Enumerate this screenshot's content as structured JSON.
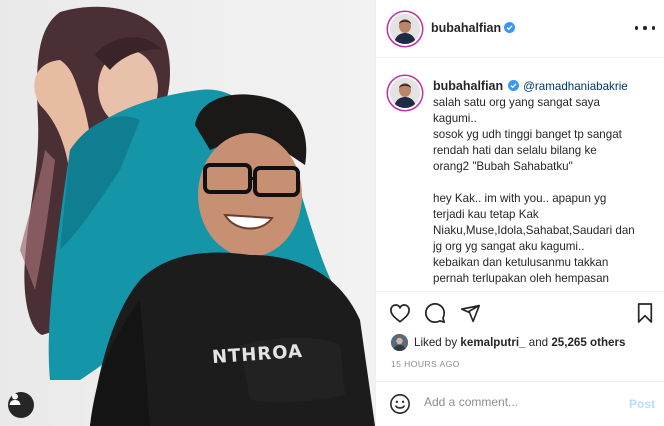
{
  "post": {
    "image_alt": "photo",
    "shirt_text": "NTHROA"
  },
  "header": {
    "username": "bubahalfian",
    "verified_icon": "verified-badge-icon",
    "more_icon": "more-options-icon"
  },
  "caption": {
    "username": "bubahalfian",
    "mention": "@ramadhaniabakrie",
    "lines": [
      "salah satu org yang sangat saya",
      "kagumi..",
      "sosok yg udh tinggi banget tp sangat",
      "rendah hati dan selalu bilang ke",
      "orang2 \"Bubah Sahabatku\"",
      "",
      "hey Kak.. im with you.. apapun yg",
      "terjadi kau tetap Kak",
      "Niaku,Muse,Idola,Sahabat,Saudari dan",
      "jg org yg sangat aku kagumi..",
      "kebaikan dan ketulusanmu takkan",
      "pernah terlupakan oleh hempasan"
    ]
  },
  "actions": {
    "like_icon": "heart-icon",
    "comment_icon": "comment-icon",
    "share_icon": "share-icon",
    "save_icon": "bookmark-icon"
  },
  "likes": {
    "prefix": "Liked by",
    "user": "kemalputri_",
    "connector": "and",
    "others": "25,265 others"
  },
  "timestamp": "15 HOURS AGO",
  "comment_box": {
    "placeholder": "Add a comment...",
    "post_label": "Post",
    "emoji_icon": "smiley-icon"
  },
  "colors": {
    "verified": "#3897f0",
    "mention": "#00376b",
    "post_disabled": "#b2dffc",
    "jacket": "#1595a8"
  }
}
